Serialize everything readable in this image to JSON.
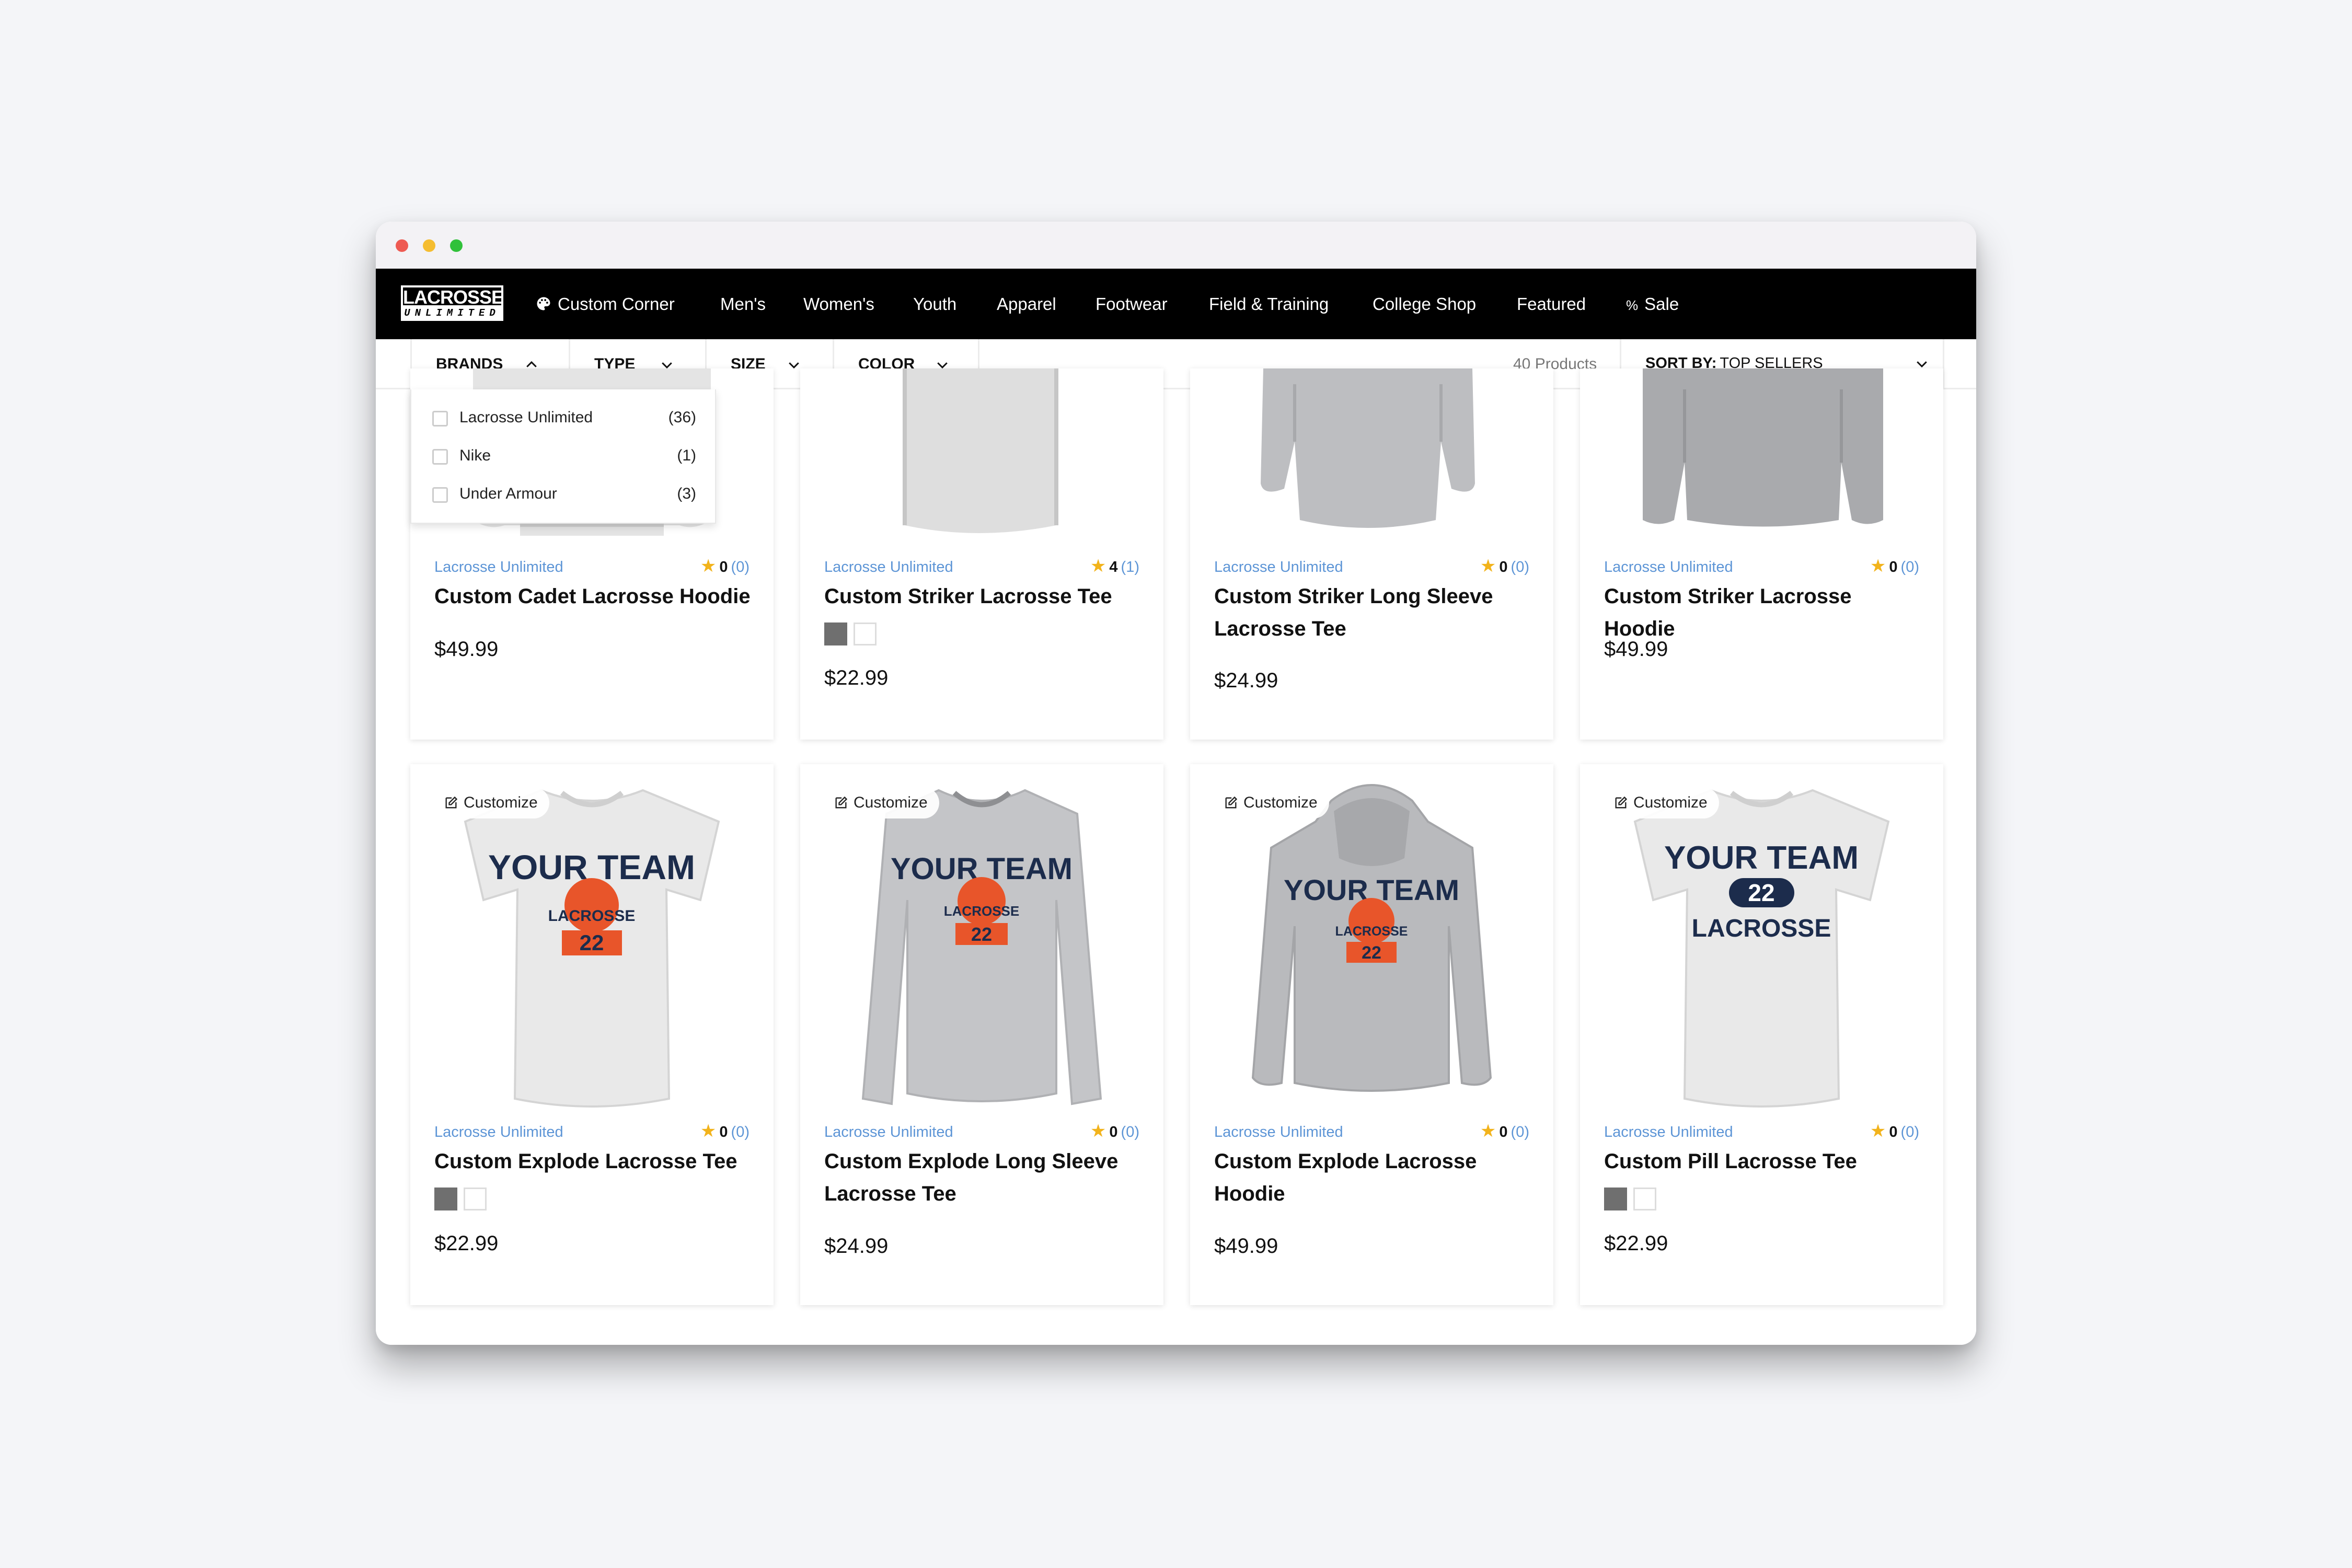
{
  "nav": {
    "logo_top": "LACROSSE",
    "logo_bottom": "UNLIMITED",
    "items": [
      {
        "label": "Custom Corner",
        "icon": "palette-icon"
      },
      {
        "label": "Men's"
      },
      {
        "label": "Women's"
      },
      {
        "label": "Youth"
      },
      {
        "label": "Apparel"
      },
      {
        "label": "Footwear"
      },
      {
        "label": "Field & Training"
      },
      {
        "label": "College Shop"
      },
      {
        "label": "Featured"
      },
      {
        "label": "Sale",
        "icon": "percent-icon"
      }
    ]
  },
  "filters": {
    "items": [
      {
        "label": "BRANDS"
      },
      {
        "label": "TYPE"
      },
      {
        "label": "SIZE"
      },
      {
        "label": "COLOR"
      }
    ],
    "product_count": "40 Products",
    "sort_prefix": "SORT BY:",
    "sort_value": "TOP SELLERS"
  },
  "brands_dropdown": {
    "options": [
      {
        "label": "Lacrosse Unlimited",
        "count": "(36)"
      },
      {
        "label": "Nike",
        "count": "(1)"
      },
      {
        "label": "Under Armour",
        "count": "(3)"
      }
    ]
  },
  "customize_label": "Customize",
  "products": [
    {
      "brand": "Lacrosse Unlimited",
      "rating": "0",
      "reviews": "(0)",
      "title": "Custom Cadet Lacrosse Hoodie",
      "price": "$49.99"
    },
    {
      "brand": "Lacrosse Unlimited",
      "rating": "4",
      "reviews": "(1)",
      "title": "Custom Striker Lacrosse Tee",
      "price": "$22.99"
    },
    {
      "brand": "Lacrosse Unlimited",
      "rating": "0",
      "reviews": "(0)",
      "title": "Custom Striker Long Sleeve Lacrosse Tee",
      "price": "$24.99"
    },
    {
      "brand": "Lacrosse Unlimited",
      "rating": "0",
      "reviews": "(0)",
      "title": "Custom Striker Lacrosse Hoodie",
      "price": "$49.99"
    },
    {
      "brand": "Lacrosse Unlimited",
      "rating": "0",
      "reviews": "(0)",
      "title": "Custom Explode Lacrosse Tee",
      "price": "$22.99"
    },
    {
      "brand": "Lacrosse Unlimited",
      "rating": "0",
      "reviews": "(0)",
      "title": "Custom Explode Long Sleeve Lacrosse Tee",
      "price": "$24.99"
    },
    {
      "brand": "Lacrosse Unlimited",
      "rating": "0",
      "reviews": "(0)",
      "title": "Custom Explode Lacrosse Hoodie",
      "price": "$49.99"
    },
    {
      "brand": "Lacrosse Unlimited",
      "rating": "0",
      "reviews": "(0)",
      "title": "Custom Pill Lacrosse Tee",
      "price": "$22.99"
    }
  ],
  "shirt_print": {
    "line1": "YOUR TEAM",
    "line2": "LACROSSE",
    "number": "22"
  },
  "colors": {
    "brand_link": "#5d95d6",
    "star": "#f2b31b",
    "navy_print": "#1c2c4c",
    "orange_print": "#e8552a"
  }
}
